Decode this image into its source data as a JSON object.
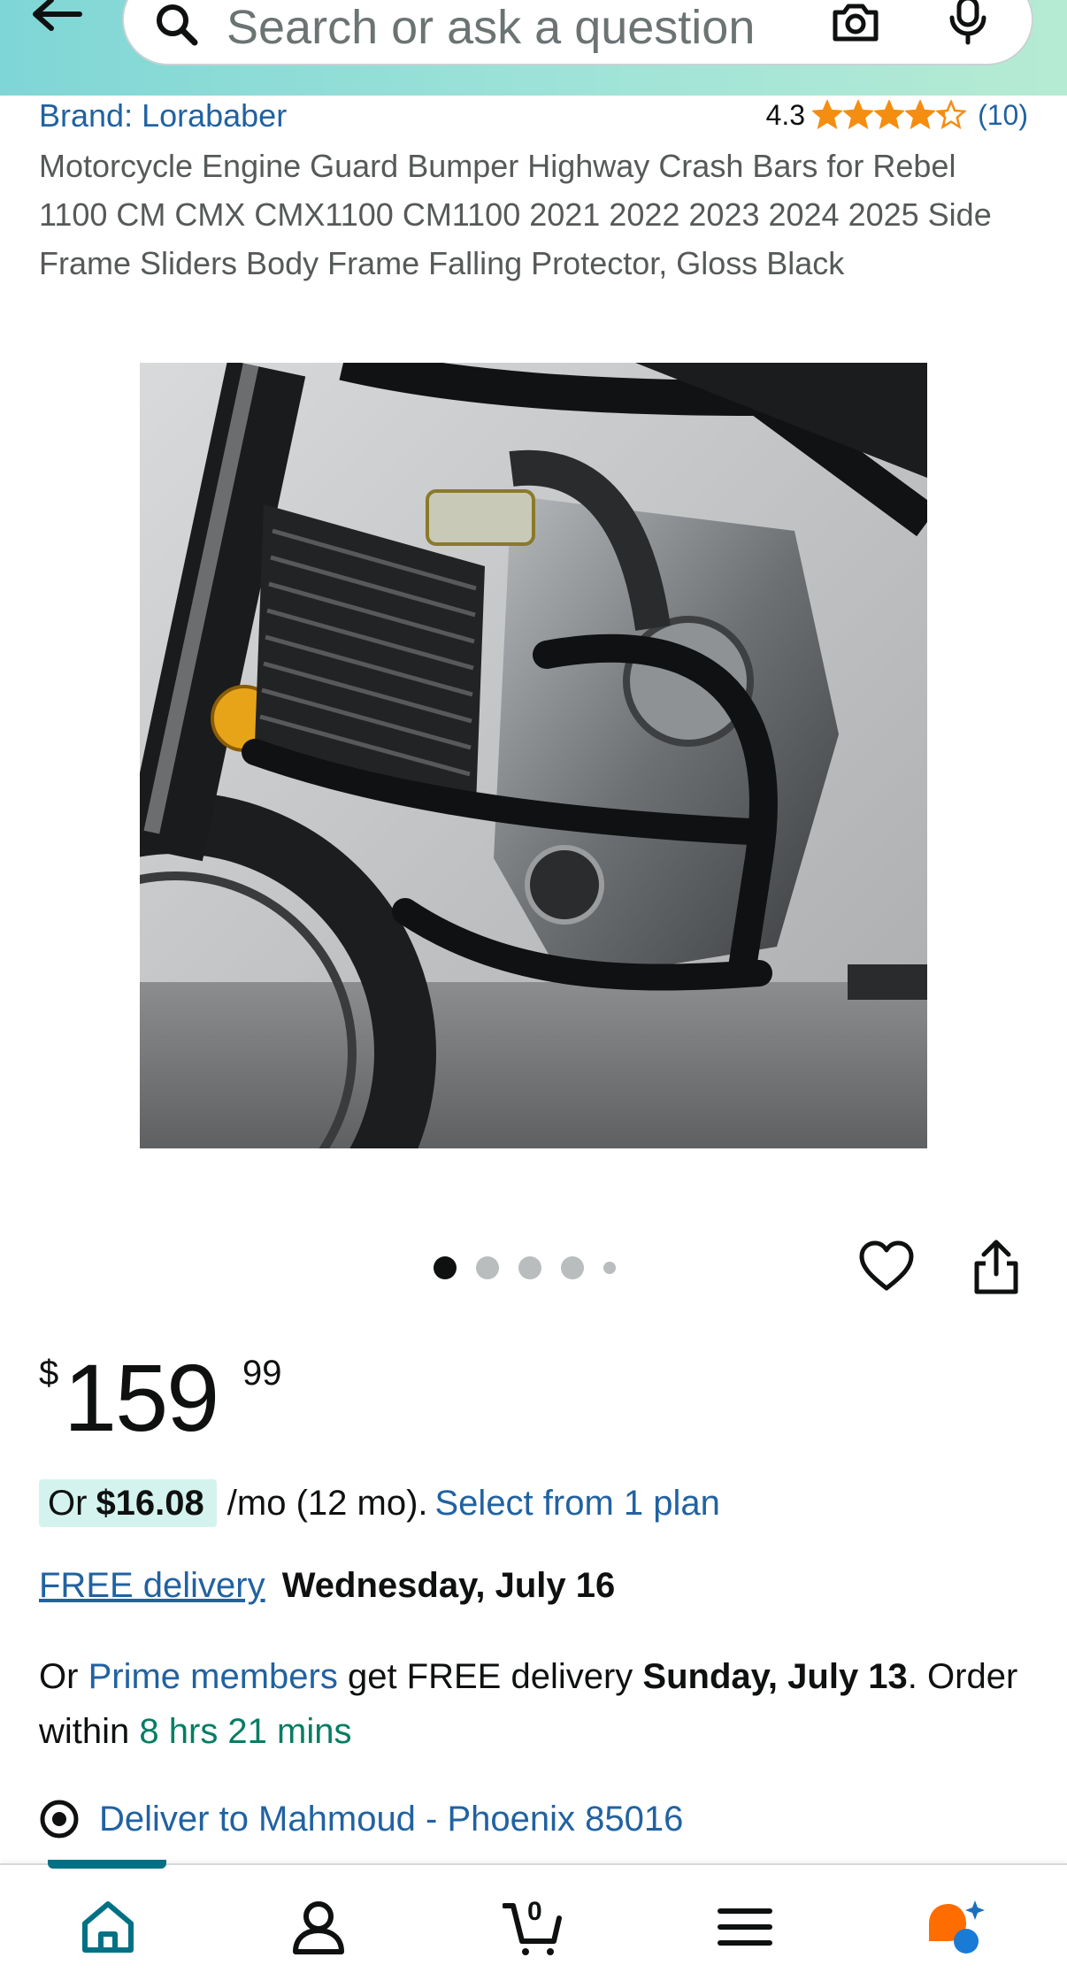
{
  "header": {
    "search_placeholder": "Search or ask a question",
    "back_icon": "arrow-left-icon",
    "search_icon": "search-icon",
    "camera_icon": "camera-icon",
    "mic_icon": "microphone-icon"
  },
  "product": {
    "brand": "Brand: Lorababer",
    "rating": "4.3",
    "rating_value": 4.3,
    "review_count": "(10)",
    "title": "Motorcycle Engine Guard Bumper Highway Crash Bars for Rebel 1100 CM CMX CMX1100 CM1100 2021 2022 2023 2024 2025 Side Frame Sliders Body Frame Falling Protector, Gloss Black",
    "image": {
      "semantic": "product-photo"
    },
    "carousel": {
      "total": 5,
      "active": 1
    }
  },
  "price": {
    "symbol": "$",
    "whole": "159",
    "fraction": "99"
  },
  "installment": {
    "prefix": "Or",
    "amount": "$16.08",
    "terms": "/mo (12 mo).",
    "link": "Select from 1 plan"
  },
  "delivery": {
    "link": "FREE delivery",
    "date": "Wednesday, July 16"
  },
  "prime": {
    "prefix": "Or",
    "link": "Prime members",
    "middle": "get FREE delivery",
    "date": "Sunday, July 13",
    "order_within": ". Order within",
    "countdown": "8 hrs 21 mins"
  },
  "deliver_to": {
    "text": "Deliver to Mahmoud - Phoenix 85016"
  },
  "bottom_nav": {
    "cart_count": "0",
    "items": [
      "home-icon",
      "account-icon",
      "cart-icon",
      "menu-icon",
      "rufus-assistant-icon"
    ]
  },
  "colors": {
    "link": "#2162a1",
    "star": "#f58d11",
    "countdown": "#067d62",
    "nav_active": "#007185",
    "header_start": "#7fd6d6",
    "header_end": "#b6ebd3",
    "installment_bg": "#d4f3ee"
  }
}
